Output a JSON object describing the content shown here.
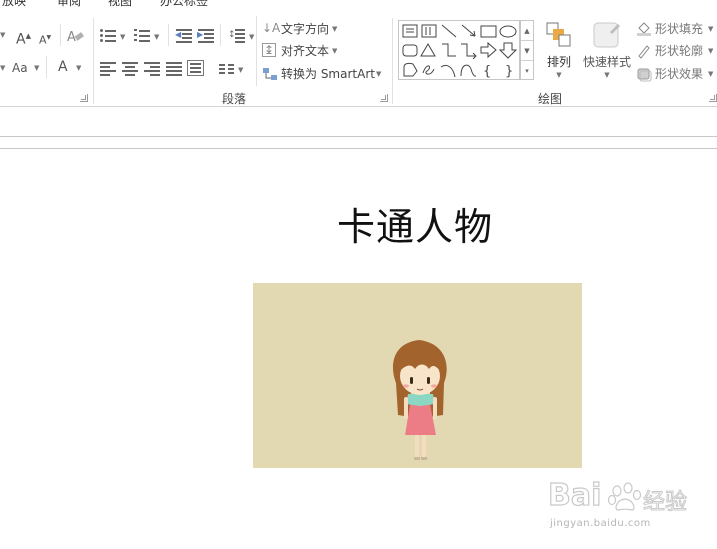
{
  "ribbon_tabs": [
    "放映",
    "审阅",
    "视图",
    "办公标签"
  ],
  "font_group": {
    "grow_font_label": "A",
    "shrink_font_label": "A",
    "change_case_label": "Aa",
    "font_color_label": "A"
  },
  "paragraph_group": {
    "label": "段落",
    "text_direction": "文字方向",
    "align_text": "对齐文本",
    "convert_smartart": "转换为 SmartArt"
  },
  "drawing_group": {
    "label": "绘图",
    "arrange": "排列",
    "quick_styles": "快速样式",
    "shape_fill": "形状填充",
    "shape_outline": "形状轮廓",
    "shape_effects": "形状效果"
  },
  "shape_gallery_icons": [
    "text-box-icon",
    "vertical-text-box-icon",
    "line-icon",
    "arrow-line-icon",
    "rectangle-icon",
    "oval-icon",
    "rounded-rectangle-icon",
    "triangle-icon",
    "elbow-connector-icon",
    "elbow-arrow-connector-icon",
    "right-arrow-icon",
    "down-arrow-icon",
    "freeform-icon",
    "scribble-icon",
    "arc-icon",
    "curve-icon",
    "left-brace-icon",
    "right-brace-icon"
  ],
  "slide": {
    "title": "卡通人物"
  },
  "watermark": {
    "brand": "Bai",
    "suffix": "经验",
    "url": "jingyan.baidu.com"
  },
  "colors": {
    "picture_background": "#e2d8b2",
    "ribbon_border": "#d4d4d4"
  }
}
